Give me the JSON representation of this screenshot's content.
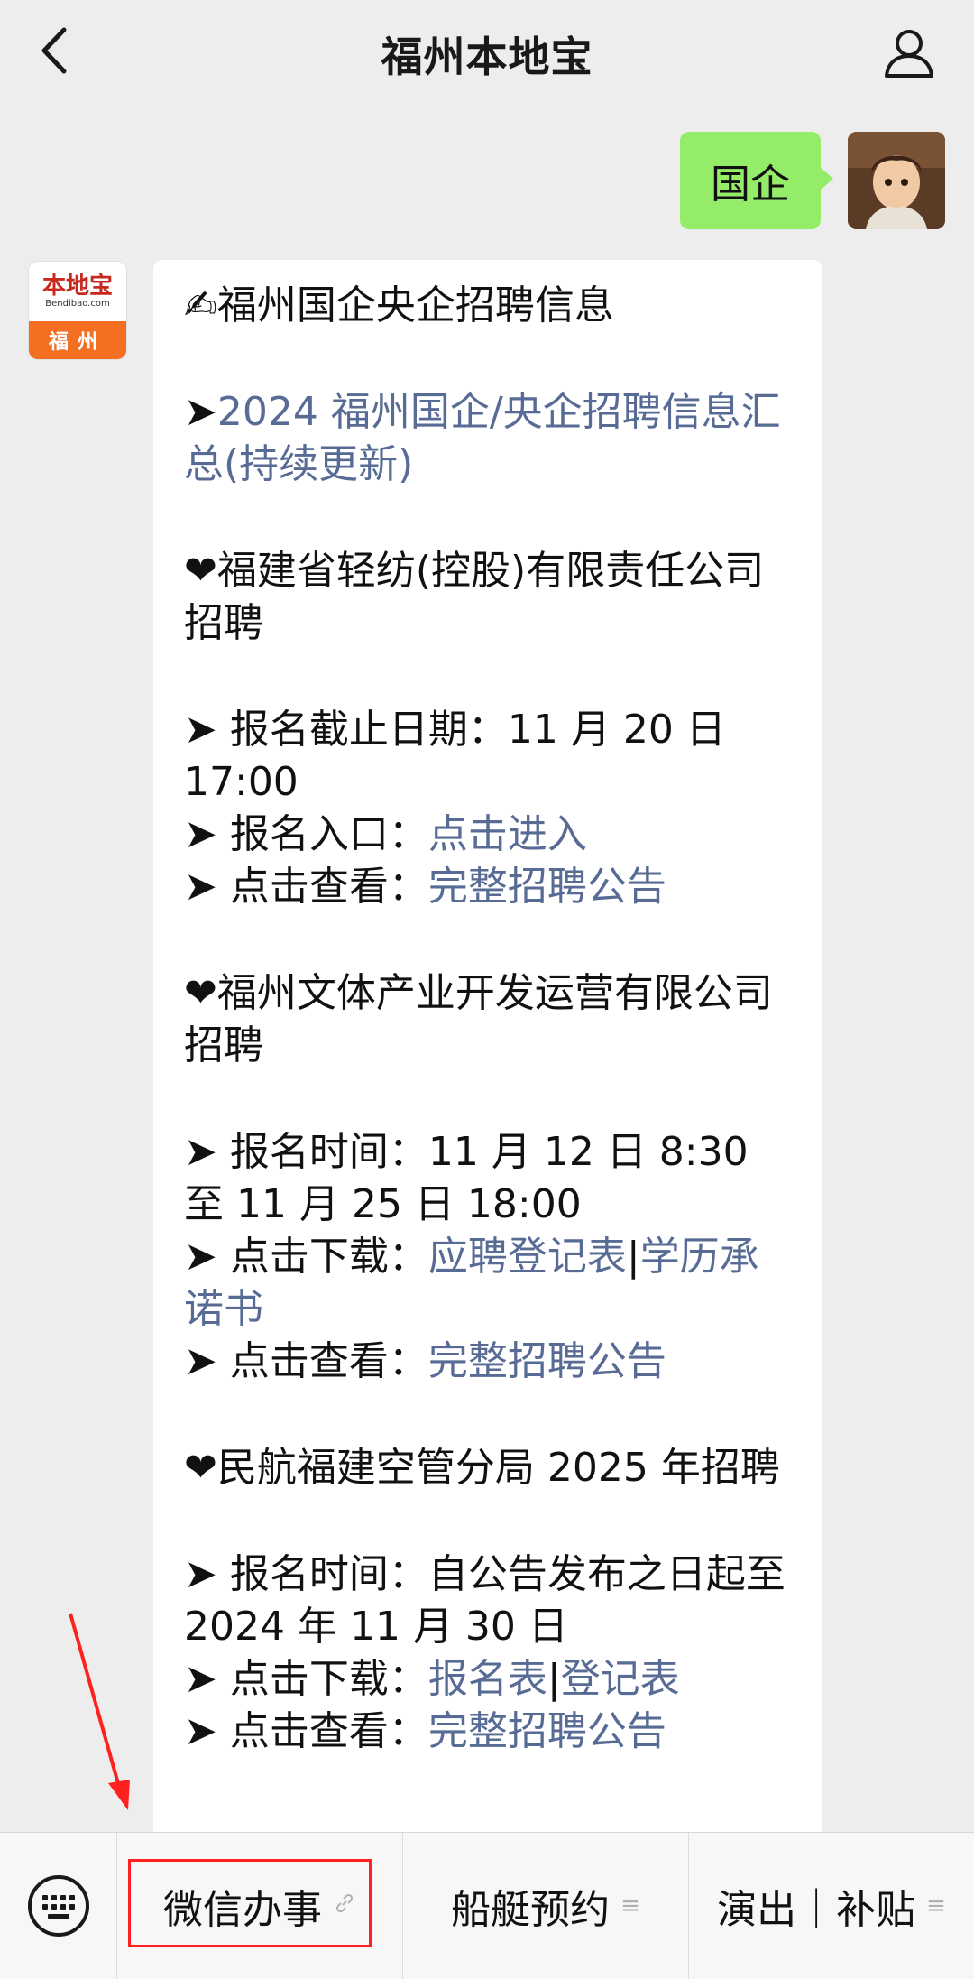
{
  "header": {
    "title": "福州本地宝",
    "back_icon": "chevron-left-icon",
    "profile_icon": "person-icon"
  },
  "outgoing": {
    "text": "国企"
  },
  "incoming_avatar": {
    "brand": "本地宝",
    "url": "Bendibao.com",
    "city": "福州"
  },
  "message": {
    "line_title": "✍福州国企央企招聘信息",
    "summary_prefix": "➤",
    "summary_link": "2024 福州国企/央企招聘信息汇总(持续更新)",
    "jobs": [
      {
        "heading": "❤福建省轻纺(控股)有限责任公司招聘",
        "rows": [
          {
            "prefix": "➤ 报名截止日期：",
            "text": "11 月 20 日 17:00",
            "links": []
          },
          {
            "prefix": "➤ 报名入口：",
            "text": "",
            "links": [
              "点击进入"
            ]
          },
          {
            "prefix": "➤ 点击查看：",
            "text": "",
            "links": [
              "完整招聘公告"
            ]
          }
        ]
      },
      {
        "heading": "❤福州文体产业开发运营有限公司招聘",
        "rows": [
          {
            "prefix": "➤ 报名时间：",
            "text": "11 月 12 日 8:30 至 11 月 25 日 18:00",
            "links": []
          },
          {
            "prefix": "➤ 点击下载：",
            "text": "",
            "links": [
              "应聘登记表",
              "学历承诺书"
            ]
          },
          {
            "prefix": "➤ 点击查看：",
            "text": "",
            "links": [
              "完整招聘公告"
            ]
          }
        ]
      },
      {
        "heading": "❤民航福建空管分局 2025 年招聘",
        "rows": [
          {
            "prefix": "➤ 报名时间：",
            "text": "自公告发布之日起至 2024 年 11 月 30 日",
            "links": []
          },
          {
            "prefix": "➤ 点击下载：",
            "text": "",
            "links": [
              "报名表",
              "登记表"
            ]
          },
          {
            "prefix": "➤ 点击查看：",
            "text": "",
            "links": [
              "完整招聘公告"
            ]
          }
        ]
      }
    ],
    "link_separator": "|"
  },
  "menu": {
    "keyboard_icon": "keyboard-icon",
    "items": [
      {
        "label": "微信办事",
        "suffix_icon": "link-icon",
        "suffix": "🔗"
      },
      {
        "label": "船艇预约",
        "suffix_icon": "menu-lines-icon",
        "suffix": "≡"
      },
      {
        "label": "演出｜补贴",
        "suffix_icon": "menu-lines-icon",
        "suffix": "≡"
      }
    ]
  },
  "colors": {
    "background": "#ededed",
    "outgoing_bubble": "#95ec69",
    "link": "#576b95",
    "annotation": "#ff2020"
  }
}
